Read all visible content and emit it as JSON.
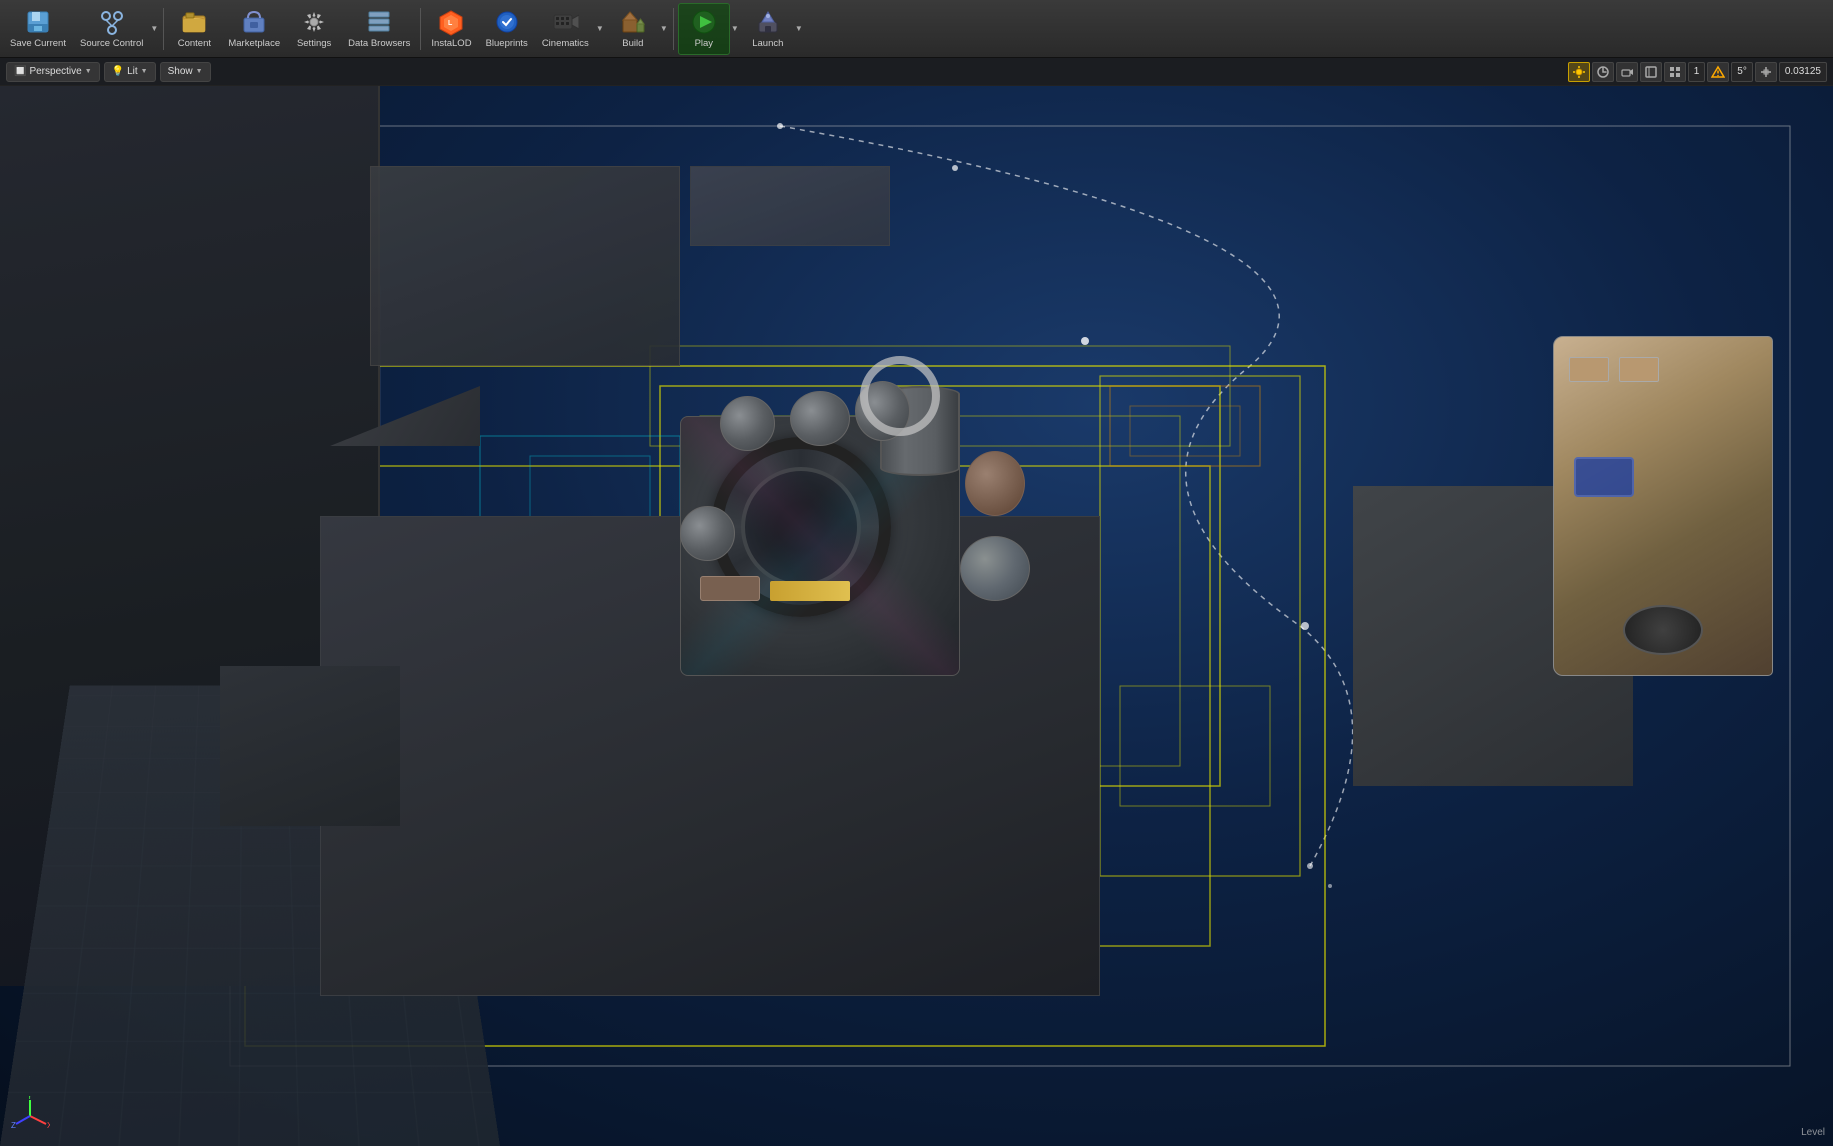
{
  "toolbar": {
    "buttons": [
      {
        "id": "save-current",
        "label": "Save Current",
        "icon": "💾",
        "has_arrow": false
      },
      {
        "id": "source-control",
        "label": "Source Control",
        "icon": "🔀",
        "has_arrow": true
      },
      {
        "id": "content",
        "label": "Content",
        "icon": "📁",
        "has_arrow": false
      },
      {
        "id": "marketplace",
        "label": "Marketplace",
        "icon": "🛒",
        "has_arrow": false
      },
      {
        "id": "settings",
        "label": "Settings",
        "icon": "⚙️",
        "has_arrow": false
      },
      {
        "id": "data-browsers",
        "label": "Data Browsers",
        "icon": "🗂️",
        "has_arrow": false
      },
      {
        "id": "instalod",
        "label": "InstaLOD",
        "icon": "🔷",
        "has_arrow": false
      },
      {
        "id": "blueprints",
        "label": "Blueprints",
        "icon": "🔵",
        "has_arrow": false
      },
      {
        "id": "cinematics",
        "label": "Cinematics",
        "icon": "🎬",
        "has_arrow": true
      },
      {
        "id": "build",
        "label": "Build",
        "icon": "🔨",
        "has_arrow": true
      },
      {
        "id": "play",
        "label": "Play",
        "icon": "▶",
        "has_arrow": true
      },
      {
        "id": "launch",
        "label": "Launch",
        "icon": "🚀",
        "has_arrow": true
      }
    ]
  },
  "viewport_toolbar": {
    "perspective_label": "Perspective",
    "lit_label": "Lit",
    "show_label": "Show",
    "right_icons": [
      "🔆",
      "🔍",
      "📷",
      "🎯",
      "📊",
      "☰",
      "1",
      "⚠",
      "5°",
      "⤢",
      "0.03125"
    ],
    "zoom_value": "0.03125",
    "angle_value": "5°",
    "counter_value": "1"
  },
  "scene": {
    "level_text": "Level"
  },
  "colors": {
    "toolbar_bg": "#2e2e2e",
    "viewport_bg": "#0a1a2e",
    "accent_yellow": "#dcdc00",
    "accent_cyan": "#00c8dc",
    "accent_pink": "#dc64b4",
    "accent_green": "#32c850",
    "text_dim": "#888888"
  }
}
